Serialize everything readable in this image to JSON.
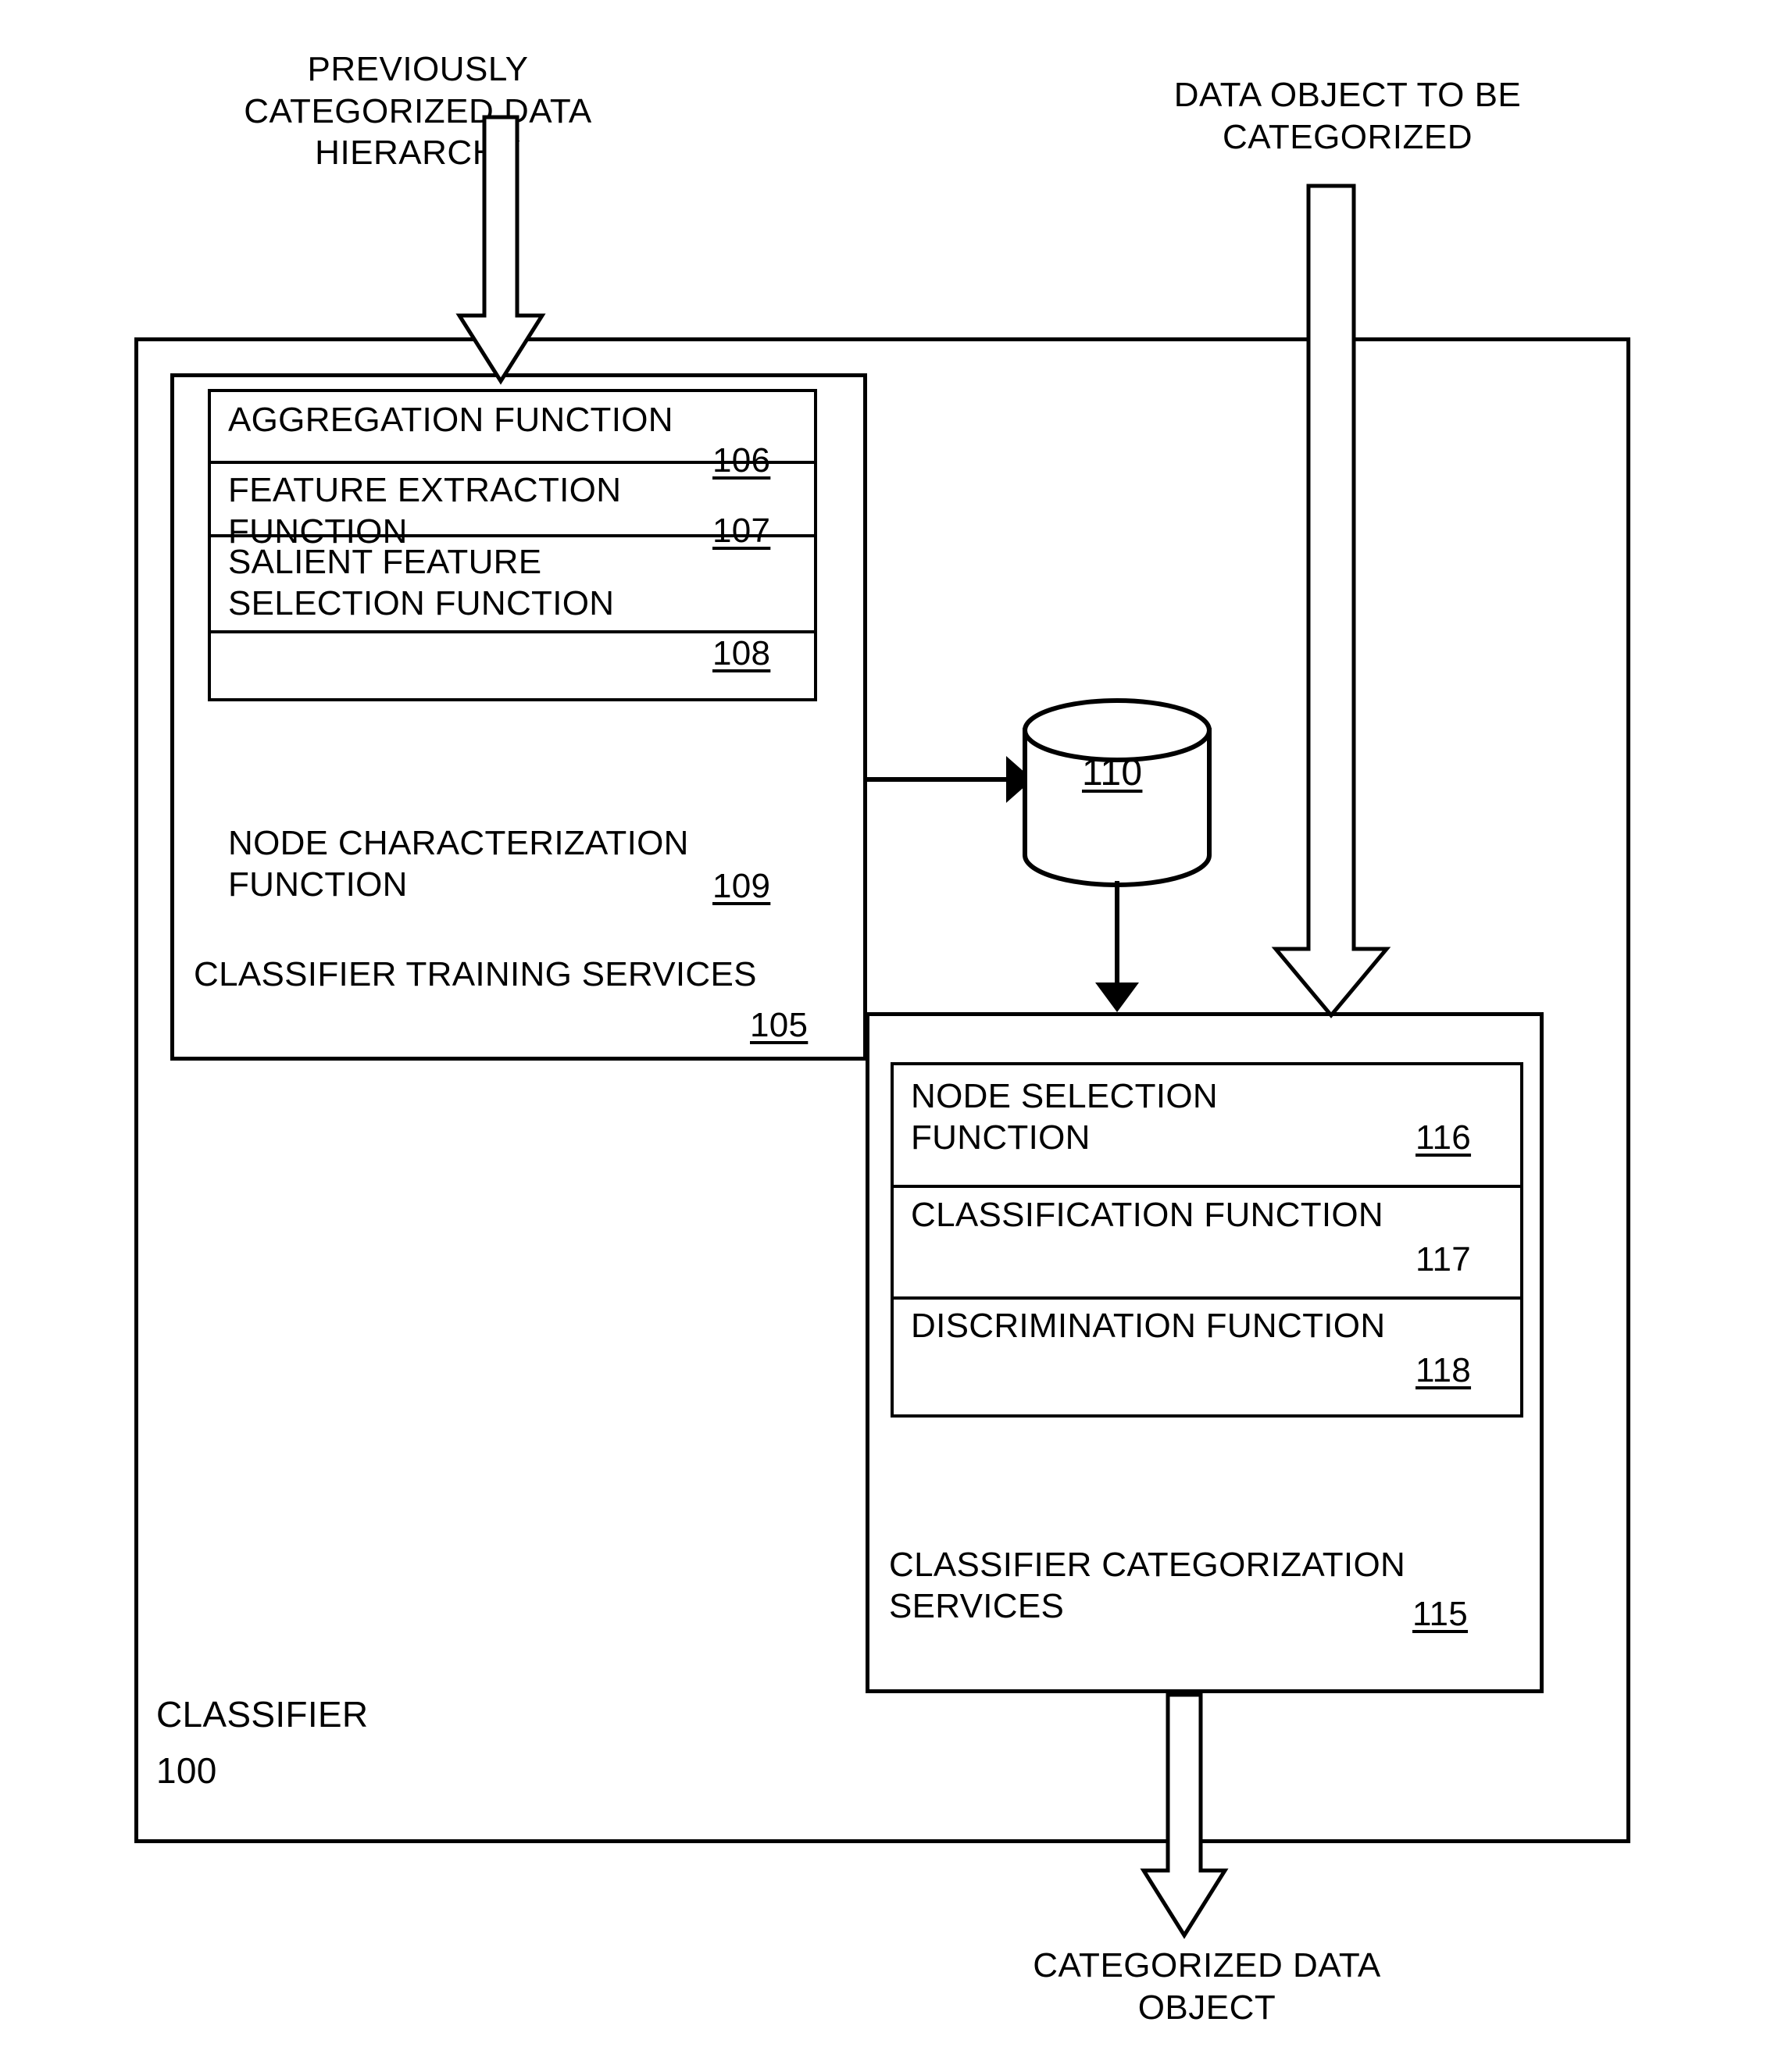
{
  "figure": {
    "inputs": {
      "training_input": "PREVIOUSLY\nCATEGORIZED DATA\nHIERARCHY",
      "object_input": "DATA OBJECT TO BE\nCATEGORIZED"
    },
    "output": {
      "result": "CATEGORIZED DATA\nOBJECT"
    },
    "classifier": {
      "label": "CLASSIFIER",
      "ref": "100"
    },
    "training_services": {
      "label": "CLASSIFIER TRAINING SERVICES",
      "ref": "105",
      "ref_underlined": true,
      "functions": [
        {
          "label": "AGGREGATION FUNCTION",
          "ref": "106",
          "ref_underlined": true
        },
        {
          "label": "FEATURE EXTRACTION\nFUNCTION",
          "ref": "107",
          "ref_underlined": true
        },
        {
          "label": "SALIENT FEATURE\nSELECTION FUNCTION",
          "ref": "108",
          "ref_underlined": true
        },
        {
          "label": "NODE CHARACTERIZATION\nFUNCTION",
          "ref": "109",
          "ref_underlined": true
        }
      ]
    },
    "datastore": {
      "ref": "110",
      "ref_underlined": true
    },
    "categorization_services": {
      "label": "CLASSIFIER CATEGORIZATION\nSERVICES",
      "ref": "115",
      "ref_underlined": true,
      "functions": [
        {
          "label": "NODE SELECTION\nFUNCTION",
          "ref": "116",
          "ref_underlined": true
        },
        {
          "label": "CLASSIFICATION FUNCTION",
          "ref": "117",
          "ref_underlined": false
        },
        {
          "label": "DISCRIMINATION FUNCTION",
          "ref": "118",
          "ref_underlined": true
        }
      ]
    },
    "colors": {
      "ink": "#000000",
      "paper": "#ffffff"
    }
  }
}
